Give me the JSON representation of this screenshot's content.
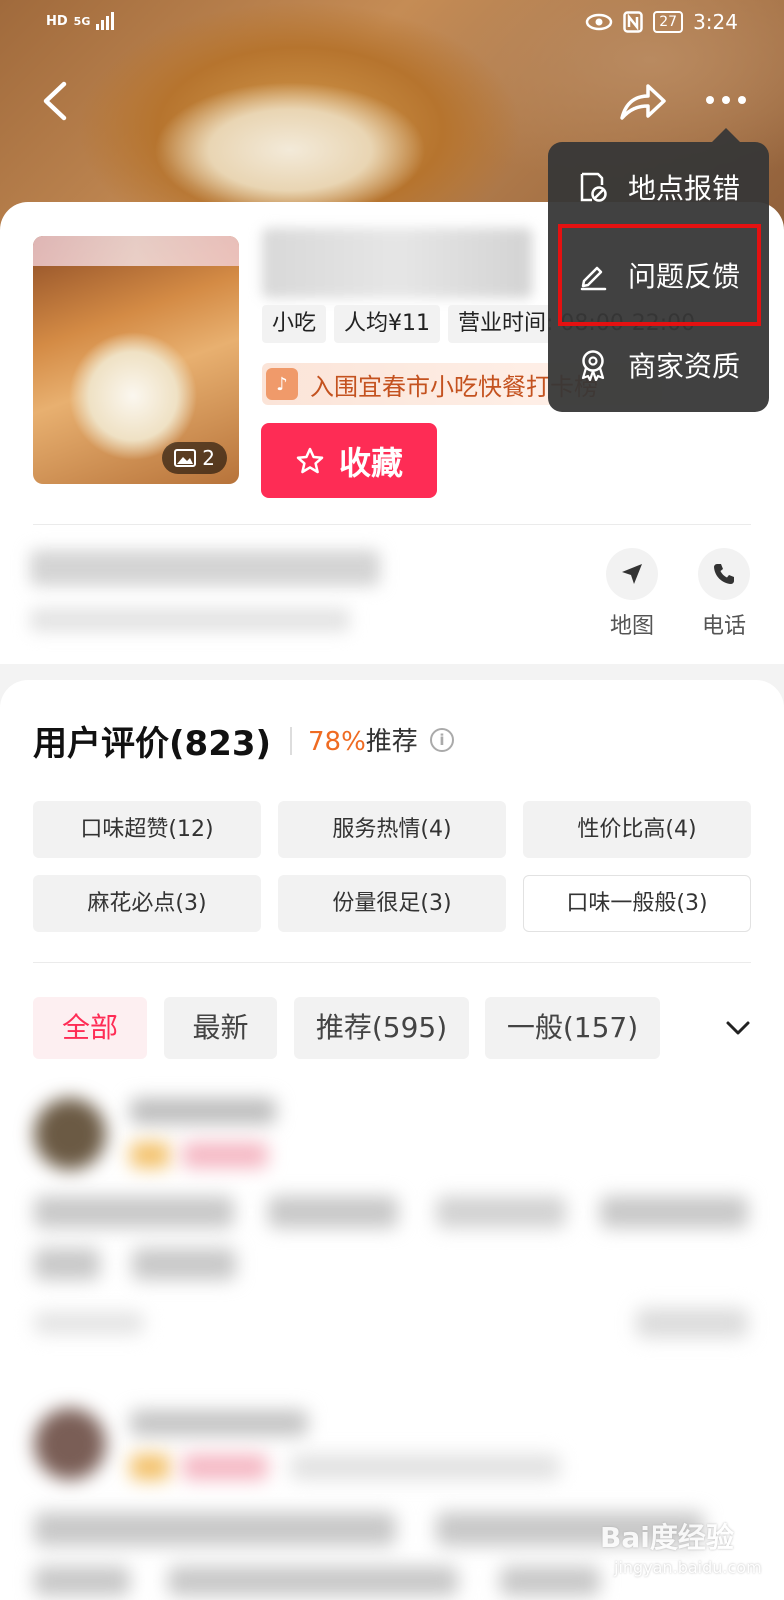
{
  "status_bar": {
    "network": "HD",
    "network_type": "5G",
    "battery": "27",
    "time": "3:24"
  },
  "shop": {
    "tags": [
      "小吃",
      "人均¥11",
      "营业时间: 08:00-22:00"
    ],
    "photo_count": "2",
    "rank_text": "入围宜春市小吃快餐打卡榜",
    "favorite_label": "收藏"
  },
  "actions": {
    "map_label": "地图",
    "phone_label": "电话"
  },
  "menu": {
    "items": [
      {
        "label": "地点报错",
        "icon": "report-location-icon"
      },
      {
        "label": "问题反馈",
        "icon": "edit-feedback-icon"
      },
      {
        "label": "商家资质",
        "icon": "merchant-badge-icon"
      }
    ]
  },
  "reviews": {
    "title": "用户评价(823)",
    "recommend_pct": "78%",
    "recommend_label": "推荐",
    "chips": [
      "口味超赞(12)",
      "服务热情(4)",
      "性价比高(4)",
      "麻花必点(3)",
      "份量很足(3)",
      "口味一般般(3)"
    ],
    "filters": [
      "全部",
      "最新",
      "推荐(595)",
      "一般(157)"
    ]
  },
  "watermark": {
    "logo": "Bai度经验",
    "url": "jingyan.baidu.com"
  },
  "colors": {
    "accent": "#fe2c55",
    "highlight_box": "#e41111",
    "recommend_pct": "#ef6b22"
  }
}
